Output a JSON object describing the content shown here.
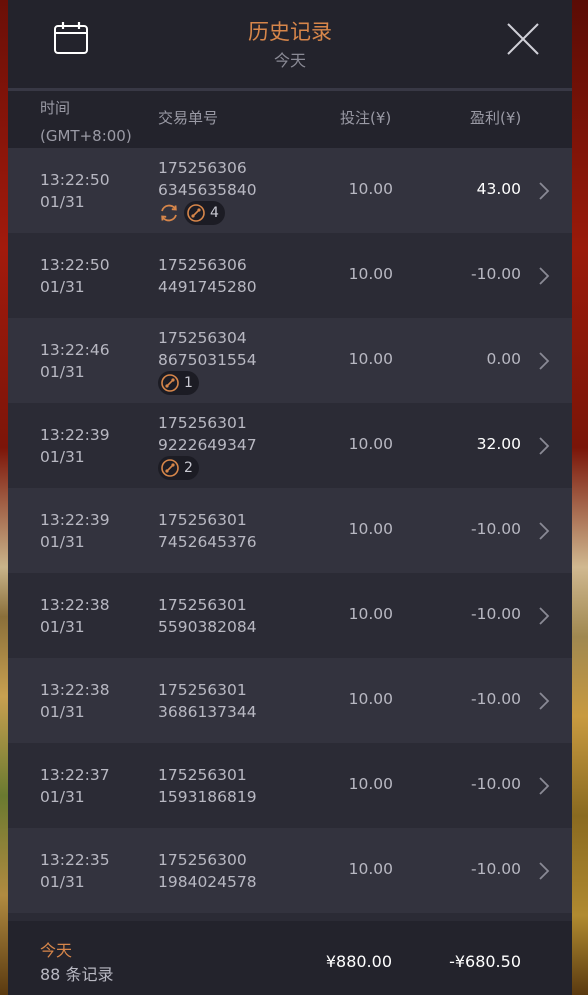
{
  "header": {
    "title": "历史记录",
    "subtitle": "今天"
  },
  "columns": {
    "time": "时间",
    "timezone": "(GMT+8:00)",
    "trade_id": "交易单号",
    "bet": "投注(¥)",
    "profit": "盈利(¥)"
  },
  "rows": [
    {
      "time": "13:22:50",
      "date": "01/31",
      "id_line1": "175256306",
      "id_line2": "6345635840",
      "bet": "10.00",
      "profit": "43.00",
      "win": true,
      "badge_count": "4"
    },
    {
      "time": "13:22:50",
      "date": "01/31",
      "id_line1": "175256306",
      "id_line2": "4491745280",
      "bet": "10.00",
      "profit": "-10.00",
      "win": false
    },
    {
      "time": "13:22:46",
      "date": "01/31",
      "id_line1": "175256304",
      "id_line2": "8675031554",
      "bet": "10.00",
      "profit": "0.00",
      "win": false,
      "badge_count": "1"
    },
    {
      "time": "13:22:39",
      "date": "01/31",
      "id_line1": "175256301",
      "id_line2": "9222649347",
      "bet": "10.00",
      "profit": "32.00",
      "win": true,
      "badge_count": "2"
    },
    {
      "time": "13:22:39",
      "date": "01/31",
      "id_line1": "175256301",
      "id_line2": "7452645376",
      "bet": "10.00",
      "profit": "-10.00",
      "win": false
    },
    {
      "time": "13:22:38",
      "date": "01/31",
      "id_line1": "175256301",
      "id_line2": "5590382084",
      "bet": "10.00",
      "profit": "-10.00",
      "win": false
    },
    {
      "time": "13:22:38",
      "date": "01/31",
      "id_line1": "175256301",
      "id_line2": "3686137344",
      "bet": "10.00",
      "profit": "-10.00",
      "win": false
    },
    {
      "time": "13:22:37",
      "date": "01/31",
      "id_line1": "175256301",
      "id_line2": "1593186819",
      "bet": "10.00",
      "profit": "-10.00",
      "win": false
    },
    {
      "time": "13:22:35",
      "date": "01/31",
      "id_line1": "175256300",
      "id_line2": "1984024578",
      "bet": "10.00",
      "profit": "-10.00",
      "win": false
    }
  ],
  "footer": {
    "period": "今天",
    "record_count": "88 条记录",
    "total_bet": "¥880.00",
    "total_profit": "-¥680.50"
  },
  "colors": {
    "accent": "#d7864a",
    "panel": "#2b2b35",
    "row_alt": "#33333e",
    "header": "#23232c"
  },
  "icons": {
    "calendar": "calendar-icon",
    "close": "close-icon",
    "chevron": "chevron-right-icon",
    "respin": "respin-icon",
    "free_spin": "free-spin-icon"
  }
}
